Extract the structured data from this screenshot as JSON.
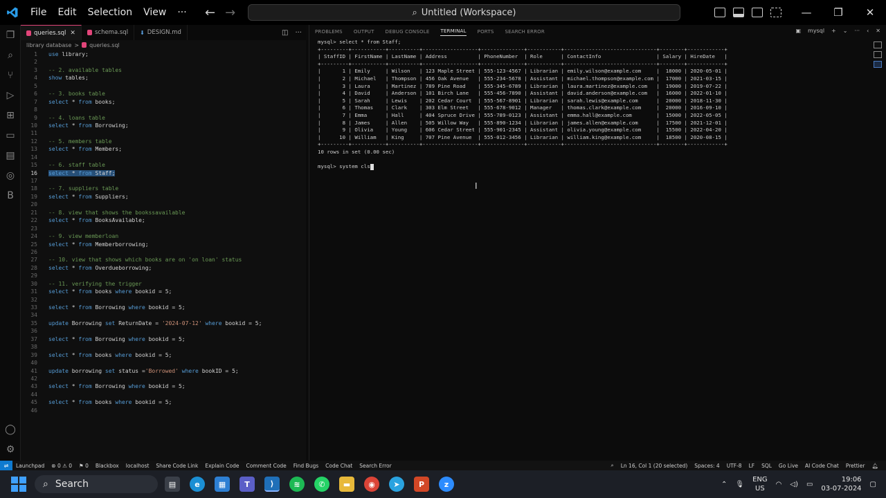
{
  "window": {
    "menus": [
      "File",
      "Edit",
      "Selection",
      "View",
      "···"
    ],
    "search_text": "Untitled (Workspace)",
    "controls": [
      "—",
      "❐",
      "✕"
    ]
  },
  "editor": {
    "tabs": [
      {
        "label": "queries.sql",
        "active": true
      },
      {
        "label": "schema.sql",
        "active": false
      },
      {
        "label": "DESIGN.md",
        "active": false
      }
    ],
    "breadcrumb": [
      "library database",
      ">",
      "queries.sql"
    ],
    "current_line": 16,
    "lines": [
      "use library;",
      "",
      "-- 2. available tables",
      "show tables;",
      "",
      "-- 3. books table",
      "select * from books;",
      "",
      "-- 4. loans table",
      "select * from Borrowing;",
      "",
      "-- 5. members table",
      "select * from Members;",
      "",
      "-- 6. staff table",
      "select * from Staff;",
      "",
      "-- 7. suppliers table",
      "select * from Suppliers;",
      "",
      "-- 8. view that shows the bookssavailable",
      "select * from BooksAvailable;",
      "",
      "-- 9. view memberloan",
      "select * from Memberborrowing;",
      "",
      "-- 10. view that shows which books are on 'on loan' status",
      "select * from Overdueborrowing;",
      "",
      "-- 11. verifying the trigger",
      "select * from books where bookid = 5;",
      "",
      "select * from Borrowing where bookid = 5;",
      "",
      "update Borrowing set ReturnDate = '2024-07-12' where bookid = 5;",
      "",
      "select * from Borrowing where bookid = 5;",
      "",
      "select * from books where bookid = 5;",
      "",
      "update borrowing set status ='Borrowed' where bookID = 5;",
      "",
      "select * from Borrowing where bookid = 5;",
      "",
      "select * from books where bookid = 5;",
      ""
    ]
  },
  "panel": {
    "tabs": [
      {
        "label": "PROBLEMS",
        "active": false
      },
      {
        "label": "OUTPUT",
        "active": false
      },
      {
        "label": "DEBUG CONSOLE",
        "active": false
      },
      {
        "label": "TERMINAL",
        "active": true
      },
      {
        "label": "PORTS",
        "active": false
      },
      {
        "label": "SEARCH ERROR",
        "active": false
      }
    ],
    "terminal_name": "mysql",
    "terminal": {
      "command1": "mysql> select * from Staff;",
      "columns": [
        "StaffID",
        "FirstName",
        "LastName",
        "Address",
        "PhoneNumber",
        "Role",
        "ContactInfo",
        "Salary",
        "HireDate"
      ],
      "rows": [
        [
          "1",
          "Emily",
          "Wilson",
          "123 Maple Street",
          "555-123-4567",
          "Librarian",
          "emily.wilson@example.com",
          "18000",
          "2020-05-01"
        ],
        [
          "2",
          "Michael",
          "Thompson",
          "456 Oak Avenue",
          "555-234-5678",
          "Assistant",
          "michael.thompson@example.com",
          "17000",
          "2021-03-15"
        ],
        [
          "3",
          "Laura",
          "Martinez",
          "789 Pine Road",
          "555-345-6789",
          "Librarian",
          "laura.martinez@example.com",
          "19000",
          "2019-07-22"
        ],
        [
          "4",
          "David",
          "Anderson",
          "101 Birch Lane",
          "555-456-7890",
          "Assistant",
          "david.anderson@example.com",
          "16000",
          "2022-01-10"
        ],
        [
          "5",
          "Sarah",
          "Lewis",
          "202 Cedar Court",
          "555-567-8901",
          "Librarian",
          "sarah.lewis@example.com",
          "20000",
          "2018-11-30"
        ],
        [
          "6",
          "Thomas",
          "Clark",
          "303 Elm Street",
          "555-678-9012",
          "Manager",
          "thomas.clark@example.com",
          "20000",
          "2016-09-10"
        ],
        [
          "7",
          "Emma",
          "Hall",
          "404 Spruce Drive",
          "555-789-0123",
          "Assistant",
          "emma.hall@example.com",
          "15000",
          "2022-05-05"
        ],
        [
          "8",
          "James",
          "Allen",
          "505 Willow Way",
          "555-890-1234",
          "Librarian",
          "james.allen@example.com",
          "17500",
          "2021-12-01"
        ],
        [
          "9",
          "Olivia",
          "Young",
          "606 Cedar Street",
          "555-901-2345",
          "Assistant",
          "olivia.young@example.com",
          "15500",
          "2022-04-20"
        ],
        [
          "10",
          "William",
          "King",
          "707 Pine Avenue",
          "555-012-3456",
          "Librarian",
          "william.king@example.com",
          "18500",
          "2020-08-15"
        ]
      ],
      "result_line": "10 rows in set (0.00 sec)",
      "command2": "mysql> system cls"
    }
  },
  "statusbar": {
    "left": [
      "Launchpad",
      "⊗ 0 ⚠ 0",
      "⚑ 0",
      "Blackbox",
      "localhost",
      "Share Code Link",
      "Explain Code",
      "Comment Code",
      "Find Bugs",
      "Code Chat",
      "Search Error"
    ],
    "right": [
      "Ln 16, Col 1 (20 selected)",
      "Spaces: 4",
      "UTF-8",
      "LF",
      "SQL",
      "Go Live",
      "AI Code Chat",
      "Prettier"
    ]
  },
  "taskbar": {
    "search_label": "Search",
    "lang_top": "ENG",
    "lang_bottom": "US",
    "time": "19:06",
    "date": "03-07-2024"
  },
  "colors": {
    "accent": "#0e7ad0",
    "tab_active_border": "#e2457a",
    "keyword": "#569cd6",
    "comment": "#6a9955",
    "string": "#ce9178",
    "selection": "#264f78"
  }
}
